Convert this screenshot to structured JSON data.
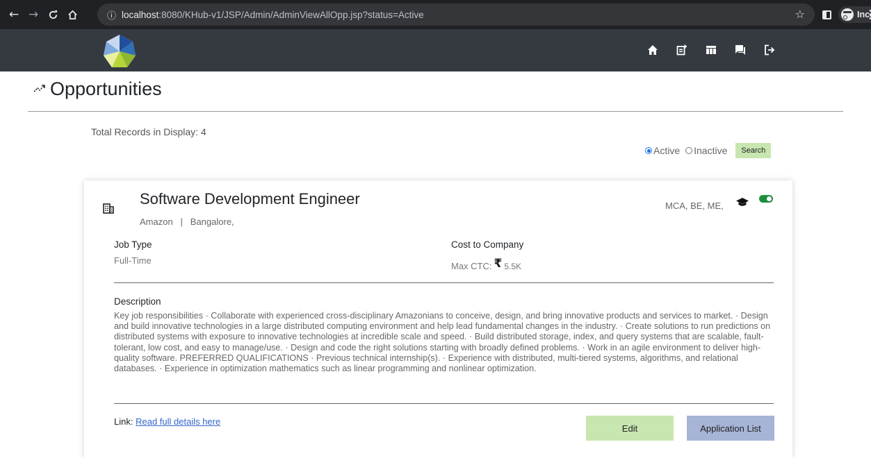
{
  "browser": {
    "url_host": "localhost",
    "url_rest": ":8080/KHub-v1/JSP/Admin/AdminViewAllOpp.jsp?status=Active",
    "incognito_label": "Incognito",
    "icons": [
      "back-icon",
      "forward-icon",
      "reload-icon",
      "home-icon",
      "info-icon",
      "star-icon",
      "sidebar-icon",
      "incognito-icon",
      "menu-icon"
    ]
  },
  "header": {
    "nav_icons": [
      "home-icon",
      "post-add-icon",
      "table-icon",
      "chat-icon",
      "logout-icon"
    ]
  },
  "page": {
    "title": "Opportunities",
    "total_records": "Total Records in Display: 4"
  },
  "filter": {
    "active_label": "Active",
    "inactive_label": "Inactive",
    "selected": "Active",
    "search_label": "Search"
  },
  "opportunity": {
    "title": "Software Development Engineer",
    "company": "Amazon",
    "separator": "|",
    "location": "Bangalore,",
    "qualifications": "MCA, BE, ME,",
    "status_on": true,
    "job_type_label": "Job Type",
    "job_type": "Full-Time",
    "ctc_label": "Cost to Company",
    "max_ctc_label": "Max CTC:",
    "currency_symbol": "₹",
    "max_ctc_value": "5.5K",
    "description_label": "Description",
    "description": "Key job responsibilities · Collaborate with experienced cross-disciplinary Amazonians to conceive, design, and bring innovative products and services to market. · Design and build innovative technologies in a large distributed computing environment and help lead fundamental changes in the industry. · Create solutions to run predictions on distributed systems with exposure to innovative technologies at incredible scale and speed. · Build distributed storage, index, and query systems that are scalable, fault-tolerant, low cost, and easy to manage/use. · Design and code the right solutions starting with broadly defined problems. · Work in an agile environment to deliver high-quality software. PREFERRED QUALIFICATIONS · Previous technical internship(s). · Experience with distributed, multi-tiered systems, algorithms, and relational databases. · Experience in optimization mathematics such as linear programming and nonlinear optimization.",
    "link_label": "Link:",
    "link_text": "Read full details here",
    "edit_label": "Edit",
    "application_list_label": "Application List"
  },
  "colors": {
    "chrome_bg": "#202124",
    "header_bg": "#343a40",
    "edit_btn": "#c8e6b0",
    "app_list_btn": "#a7b4d6",
    "toggle_on": "#1e8e3e"
  }
}
